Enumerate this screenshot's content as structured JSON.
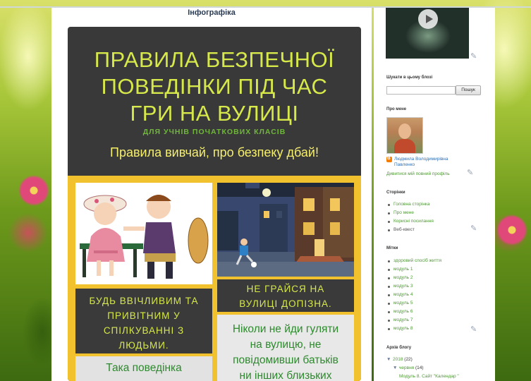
{
  "page": {
    "title": "Інфографіка"
  },
  "infographic": {
    "headline": [
      "ПРАВИЛА БЕЗПЕЧНОЇ",
      "ПОВЕДІНКИ ПІД ЧАС",
      "ГРИ НА ВУЛИЦІ"
    ],
    "subtitle": "ДЛЯ УЧНІВ ПОЧАТКОВИХ КЛАСІВ",
    "motto": "Правила вивчай, про безпеку дбай!",
    "rule1": [
      "БУДЬ ВВІЧЛИВИМ ТА",
      "ПРИВІТНИМ У",
      "СПІЛКУВАННІ З",
      "ЛЮДЬМИ."
    ],
    "rule1_text": "Така поведінка",
    "rule2": [
      "НЕ ГРАЙСЯ НА",
      "ВУЛИЦІ ДОПІЗНА."
    ],
    "rule2_text": [
      "Ніколи не йди гуляти",
      "на вулицю, не",
      "повідомивши батьків",
      "ни інших близьких"
    ]
  },
  "sidebar": {
    "search": {
      "title": "Шукати в цьому блозі",
      "button": "Пошук"
    },
    "about": {
      "title": "Про мене",
      "name_line1": "Людмила Володимирівна",
      "name_line2": "Павленко",
      "profile_link": "Дивитися мій повний профіль"
    },
    "pages": {
      "title": "Сторінки",
      "items": [
        "Головна сторінка",
        "Про мене",
        "Корисні посилання",
        "Веб-квест"
      ]
    },
    "labels": {
      "title": "Мітки",
      "items": [
        "здоровий спосіб життя",
        "модуль 1",
        "модуль 2",
        "модуль 3",
        "модуль 4",
        "модуль 5",
        "модуль 6",
        "модуль 7",
        "модуль 8"
      ]
    },
    "archive": {
      "title": "Архів блогу",
      "year": "2018",
      "year_count": "(22)",
      "month": "червня",
      "month_count": "(14)",
      "post": "Модуль 8. Сайт \"Календар \""
    }
  }
}
